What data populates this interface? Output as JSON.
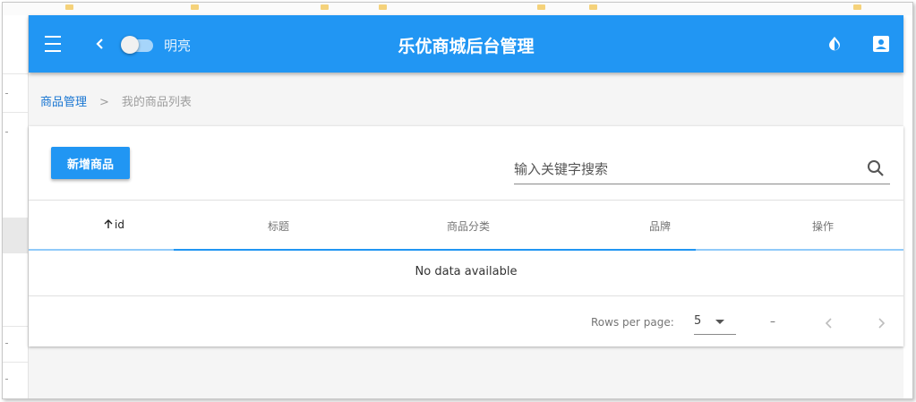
{
  "colors": {
    "primary": "#2196f3",
    "link": "#1976d2"
  },
  "appbar": {
    "title": "乐优商城后台管理",
    "theme_toggle_label": "明亮",
    "icons": [
      "menu-icon",
      "chevron-left-icon",
      "invert-colors-icon",
      "account-box-icon"
    ]
  },
  "breadcrumb": {
    "parent": "商品管理",
    "separator": ">",
    "current": "我的商品列表"
  },
  "toolbar": {
    "add_button": "新增商品",
    "search_placeholder": "输入关键字搜索",
    "search_value": ""
  },
  "table": {
    "headers": [
      "id",
      "标题",
      "商品分类",
      "品牌",
      "操作"
    ],
    "sorted_column": "id",
    "sort_direction": "ascending",
    "empty_text": "No data available"
  },
  "pagination": {
    "rows_per_page_label": "Rows per page:",
    "rows_per_page": "5",
    "range_text": "–"
  }
}
